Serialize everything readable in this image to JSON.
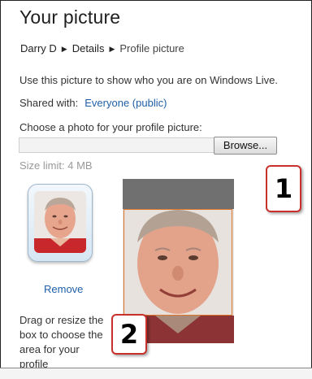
{
  "header": {
    "title": "Your picture",
    "breadcrumb": [
      {
        "label": "Darry D"
      },
      {
        "label": "Details"
      },
      {
        "label": "Profile picture"
      }
    ]
  },
  "intro": {
    "description": "Use this picture to show who you are on Windows Live.",
    "shared_label": "Shared with:",
    "shared_value": "Everyone (public)"
  },
  "upload": {
    "prompt": "Choose a photo for your profile picture:",
    "file_value": "",
    "browse_label": "Browse...",
    "size_limit": "Size limit: 4 MB"
  },
  "preview": {
    "remove_label": "Remove",
    "help_text": "Drag or resize the box to choose the area for your profile"
  },
  "callouts": {
    "one": "1",
    "two": "2"
  },
  "colors": {
    "link": "#1f5fa8",
    "crop_border": "#e0782c",
    "callout_border": "#c8302c"
  },
  "icons": {
    "breadcrumb_separator": "triangle-right-icon"
  }
}
